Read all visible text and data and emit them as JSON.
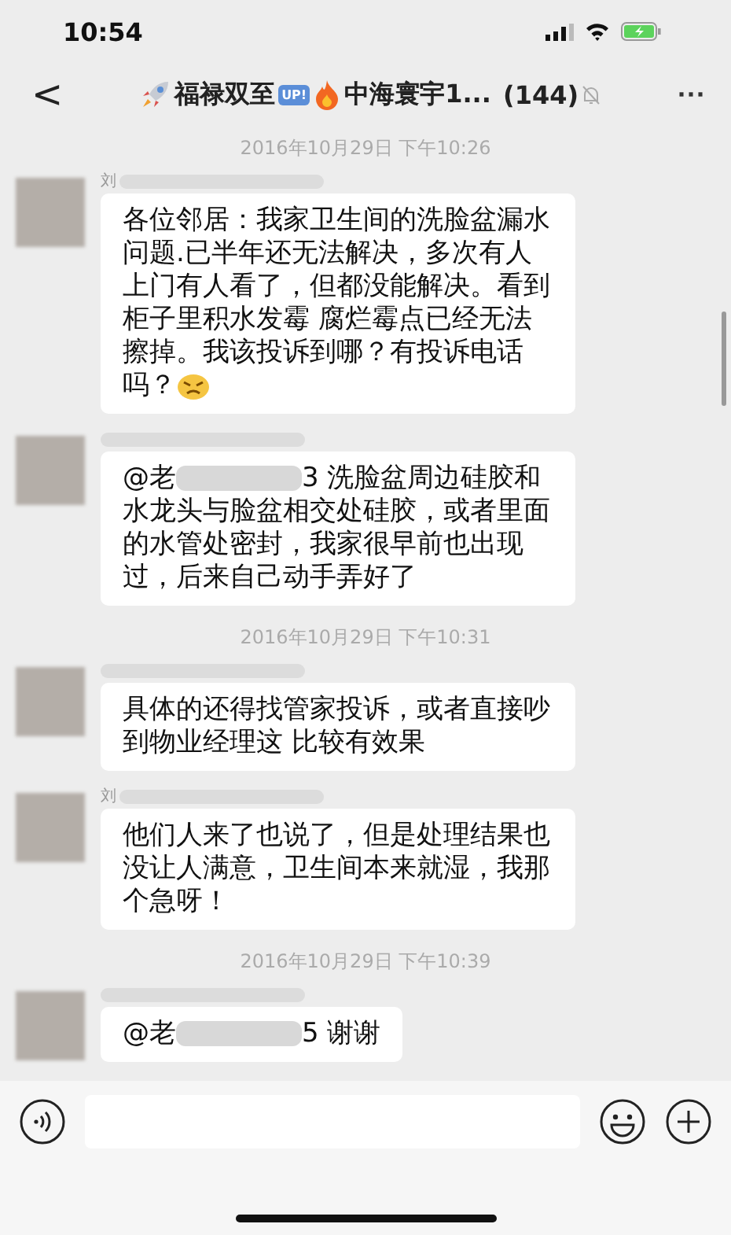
{
  "status_bar": {
    "time": "10:54"
  },
  "nav": {
    "back": "<",
    "title_parts": [
      {
        "kind": "rocket"
      },
      {
        "kind": "text",
        "text": "福禄双至"
      },
      {
        "kind": "badge",
        "text": "UP!"
      },
      {
        "kind": "fire"
      },
      {
        "kind": "text",
        "text": "中海寰宇1..."
      },
      {
        "kind": "text",
        "text": " (144)"
      }
    ],
    "muted": true,
    "more": "···"
  },
  "messages": [
    {
      "kind": "time",
      "text": "2016年10月29日 下午10:26"
    },
    {
      "kind": "message",
      "sender": "刘",
      "texts": [
        {
          "parts": [
            {
              "kind": "text",
              "text": "各位邻居：我家卫生间的洗脸盆漏水问题.已半年还无法解决，多次有人上门有人看了，但都没能解决。看到柜子里积水发霉 腐烂霉点已经无法擦掉。我该投诉到哪？有投诉电话"
            }
          ]
        },
        {
          "parts": [
            {
              "kind": "text",
              "text": "吗？"
            }
          ]
        }
      ],
      "emoji": true
    },
    {
      "kind": "message",
      "texts": [
        {
          "parts": [
            {
              "kind": "text",
              "text": "@老"
            },
            {
              "kind": "blur"
            },
            {
              "kind": "text",
              "text": "3 洗脸盆周边硅胶和水龙头与脸盆相交处硅胶，或者里面的水管处密封，我家很早前也出现过，后来自己动手弄好了"
            }
          ]
        }
      ],
      "emoji": false
    },
    {
      "kind": "time",
      "text": "2016年10月29日 下午10:31"
    },
    {
      "kind": "message",
      "texts": [
        {
          "parts": [
            {
              "kind": "text",
              "text": "具体的还得找管家投诉，或者直接吵到物业经理这 比较有效果"
            }
          ]
        }
      ],
      "emoji": false
    },
    {
      "kind": "message",
      "sender": "刘",
      "texts": [
        {
          "parts": [
            {
              "kind": "text",
              "text": "他们人来了也说了，但是处理结果也没让人满意，卫生间本来就湿，我那个急呀！"
            }
          ]
        }
      ],
      "emoji": false
    },
    {
      "kind": "time",
      "text": "2016年10月29日 下午10:39"
    },
    {
      "kind": "message",
      "texts": [
        {
          "parts": [
            {
              "kind": "text",
              "text": "@老"
            },
            {
              "kind": "blur"
            },
            {
              "kind": "text",
              "text": "5 谢谢"
            }
          ]
        }
      ],
      "emoji": false
    }
  ]
}
